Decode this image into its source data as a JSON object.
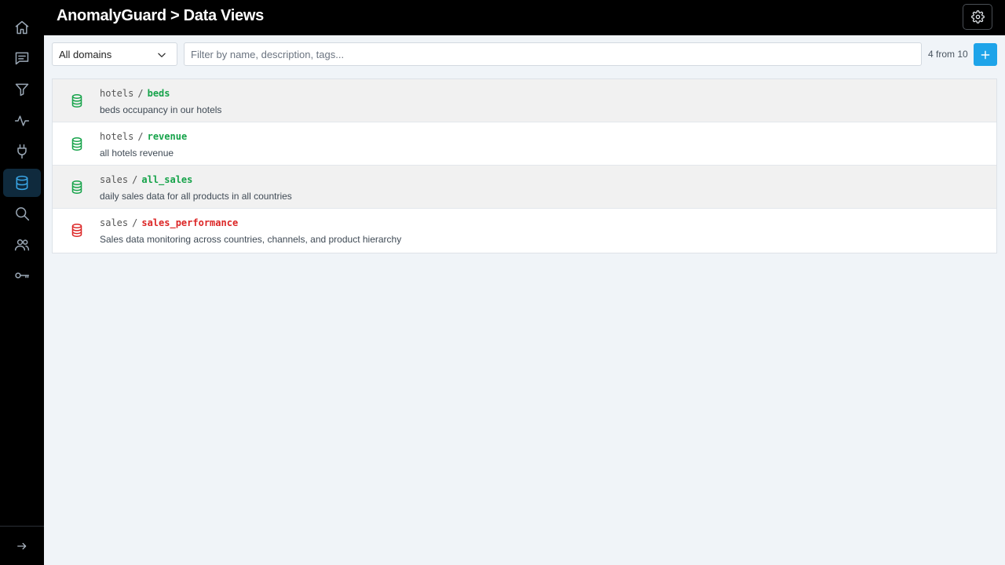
{
  "header": {
    "title": "AnomalyGuard > Data Views"
  },
  "toolbar": {
    "domain_select": "All domains",
    "filter_placeholder": "Filter by name, description, tags...",
    "count": "4 from 10"
  },
  "colors": {
    "ok": "#16a34a",
    "error": "#dc2626",
    "accent": "#1ea4e9"
  },
  "views": [
    {
      "domain": "hotels",
      "separator": "/",
      "name": "beds",
      "description": "beds occupancy in our hotels",
      "status": "ok"
    },
    {
      "domain": "hotels",
      "separator": "/",
      "name": "revenue",
      "description": "all hotels revenue",
      "status": "ok"
    },
    {
      "domain": "sales",
      "separator": "/",
      "name": "all_sales",
      "description": "daily sales data for all products in all countries",
      "status": "ok"
    },
    {
      "domain": "sales",
      "separator": "/",
      "name": "sales_performance",
      "description": "Sales data monitoring across countries, channels, and product hierarchy",
      "status": "error"
    }
  ],
  "sidebar": {
    "items": [
      {
        "icon": "home-icon"
      },
      {
        "icon": "message-icon"
      },
      {
        "icon": "filter-icon"
      },
      {
        "icon": "activity-icon"
      },
      {
        "icon": "plug-icon"
      },
      {
        "icon": "database-icon",
        "active": true
      },
      {
        "icon": "search-icon"
      },
      {
        "icon": "users-icon"
      },
      {
        "icon": "key-icon"
      }
    ]
  }
}
